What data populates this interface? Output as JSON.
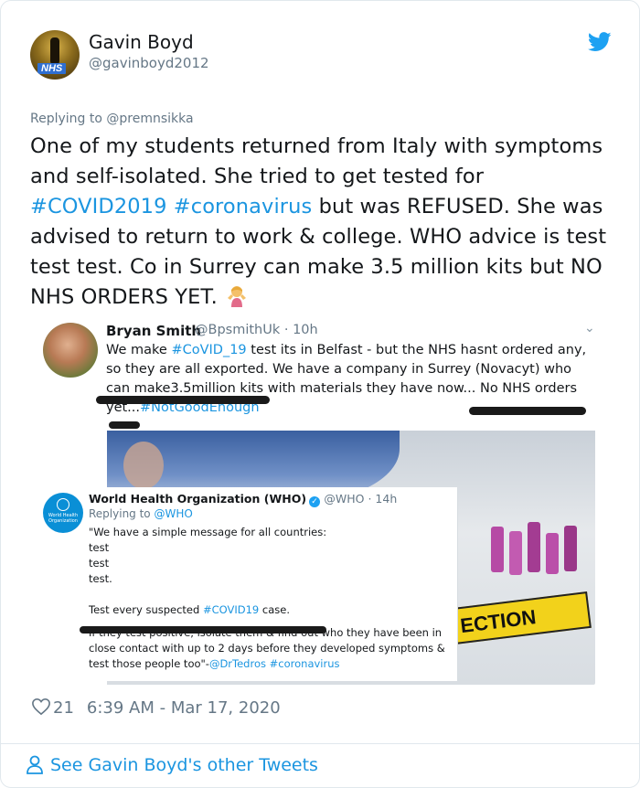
{
  "author": {
    "name": "Gavin Boyd",
    "handle": "@gavinboyd2012",
    "avatar_badge": "NHS"
  },
  "reply": {
    "prefix": "Replying to ",
    "mention": "@premnsikka"
  },
  "tweet": {
    "line1": "One of my students returned from Italy with symptoms and self-isolated. She tried to get tested for ",
    "hashtag1": "#COVID2019",
    "space": " ",
    "hashtag2": "#coronavirus",
    "line2": " but was REFUSED. She was advised to return to work & college. WHO advice is test test test. Co in Surrey can make 3.5 million kits but NO NHS ORDERS YET.",
    "emoji": "person-shrugging-emoji"
  },
  "embedded": {
    "name": "Bryan Smith",
    "handle": "@BpsmithUk · 10h",
    "text_a": "We make ",
    "tag_a": "#CoVID_19",
    "text_b": " test its in Belfast - but the NHS hasnt ordered any, so they are all exported. We have a company in Surrey (Novacyt) who can make3.5million kits with materials they have now... No NHS orders yet...",
    "tag_b": "#NotGoodEnough",
    "who": {
      "name": "World Health Organization (WHO)",
      "handle": "@WHO · 14h",
      "logo_text": "World Health Organization",
      "reply_prefix": "Replying to ",
      "reply_mention": "@WHO",
      "line1": "\"We have a simple message for all countries:",
      "line2": "test",
      "line3": "test",
      "line4": "test.",
      "line5a": "Test every suspected ",
      "line5tag": "#COVID19",
      "line5b": " case.",
      "line6a": "If they test positive, isolate them & find out who they have been in close contact with up to 2 days before they developed symptoms & test those people too\"-",
      "line6tag1": "@DrTedros",
      "line6tag2": "#coronavirus"
    },
    "tape_text": "ECTION"
  },
  "footer": {
    "likes": "21",
    "timestamp": "6:39 AM - Mar 17, 2020",
    "see_more": "See Gavin Boyd's other Tweets"
  },
  "colors": {
    "link": "#1b95e0",
    "muted": "#657786",
    "text": "#14171a",
    "twitter_blue": "#1da1f2"
  }
}
